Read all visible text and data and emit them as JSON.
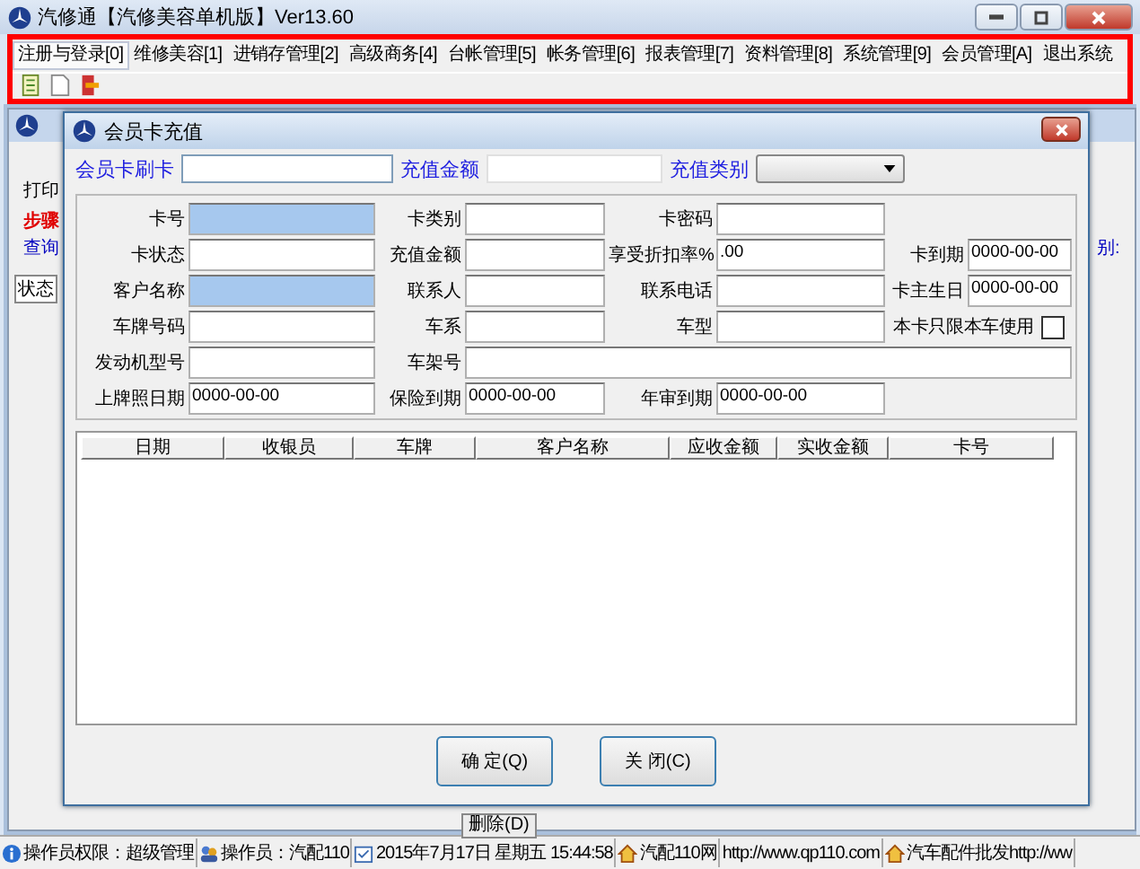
{
  "window": {
    "title": "汽修通【汽修美容单机版】Ver13.60"
  },
  "menu": [
    {
      "label": "注册与登录[0]",
      "selected": true
    },
    {
      "label": "维修美容[1]",
      "selected": false
    },
    {
      "label": "进销存管理[2]",
      "selected": false
    },
    {
      "label": "高级商务[4]",
      "selected": false
    },
    {
      "label": "台帐管理[5]",
      "selected": false
    },
    {
      "label": "帐务管理[6]",
      "selected": false
    },
    {
      "label": "报表管理[7]",
      "selected": false
    },
    {
      "label": "资料管理[8]",
      "selected": false
    },
    {
      "label": "系统管理[9]",
      "selected": false
    },
    {
      "label": "会员管理[A]",
      "selected": false
    },
    {
      "label": "退出系统",
      "selected": false
    }
  ],
  "background_window": {
    "print_label": "打印",
    "step_label": "步骤",
    "query_label": "查询",
    "status_column": "状态",
    "right_label": "别:",
    "delete_button": "删除(D)"
  },
  "dialog": {
    "title": "会员卡充值",
    "top": {
      "swipe_label": "会员卡刷卡",
      "amount_label": "充值金额",
      "type_label": "充值类别"
    },
    "rows": [
      [
        {
          "label": "卡号",
          "kind": "highlight"
        },
        {
          "label": "卡类别",
          "kind": "text"
        },
        {
          "label": "卡密码",
          "kind": "text"
        }
      ],
      [
        {
          "label": "卡状态",
          "kind": "text"
        },
        {
          "label": "充值金额",
          "kind": "text"
        },
        {
          "label": "享受折扣率%",
          "value": ".00",
          "kind": "text"
        },
        {
          "label": "卡到期",
          "value": "0000-00-00",
          "kind": "text"
        }
      ],
      [
        {
          "label": "客户名称",
          "kind": "highlight"
        },
        {
          "label": "联系人",
          "kind": "text"
        },
        {
          "label": "联系电话",
          "kind": "text"
        },
        {
          "label": "卡主生日",
          "value": "0000-00-00",
          "kind": "text"
        }
      ],
      [
        {
          "label": "车牌号码",
          "kind": "text"
        },
        {
          "label": "车系",
          "kind": "text"
        },
        {
          "label": "车型",
          "kind": "text"
        },
        {
          "label": "本卡只限本车使用",
          "checked": false,
          "kind": "checkbox"
        }
      ],
      [
        {
          "label": "发动机型号",
          "kind": "text"
        },
        {
          "label": "车架号",
          "kind": "wide"
        }
      ],
      [
        {
          "label": "上牌照日期",
          "value": "0000-00-00",
          "kind": "text"
        },
        {
          "label": "保险到期",
          "value": "0000-00-00",
          "kind": "text"
        },
        {
          "label": "年审到期",
          "value": "0000-00-00",
          "kind": "text"
        }
      ]
    ],
    "table": {
      "columns": [
        "日期",
        "收银员",
        "车牌",
        "客户名称",
        "应收金额",
        "实收金额",
        "卡号"
      ]
    },
    "buttons": [
      "确 定(Q)",
      "关 闭(C)"
    ]
  },
  "status_bar": [
    "操作员权限：超级管理",
    "操作员：汽配110",
    "2015年7月17日  星期五 15:44:58",
    "汽配110网",
    "http://www.qp110.com",
    "汽车配件批发http://ww"
  ]
}
